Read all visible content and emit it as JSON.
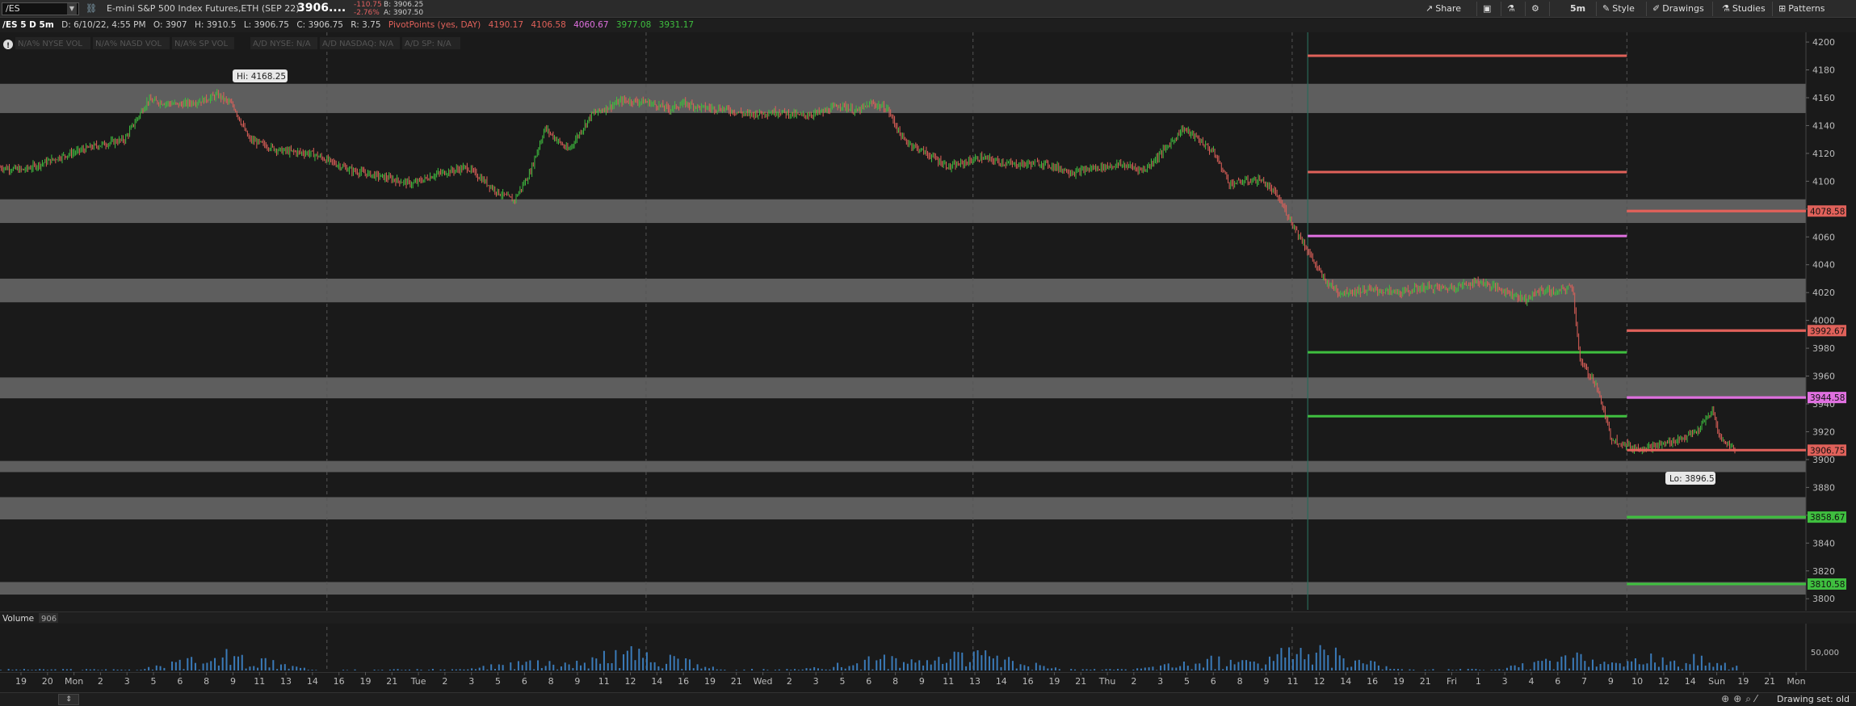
{
  "toolbar": {
    "symbol": "/ES",
    "description": "E-mini S&P 500 Index Futures,ETH (SEP 22)",
    "last": "3906....",
    "net_change": "-110.75",
    "pct_change": "-2.76%",
    "bid": "B: 3906.25",
    "ask": "A: 3907.50",
    "buttons": [
      "Share",
      "Drawings",
      "Studies",
      "Patterns"
    ],
    "style_label": "Style",
    "aggregation": "5m"
  },
  "infobar": {
    "chart_title": "/ES 5 D 5m",
    "date": "D: 6/10/22, 4:55 PM",
    "open": "O: 3907",
    "high": "H: 3910.5",
    "low": "L: 3906.75",
    "close": "C: 3906.75",
    "range": "R: 3.75",
    "pivot_label": "PivotPoints (yes, DAY)",
    "pivot_values": [
      "4190.17",
      "4106.58",
      "4060.67",
      "3977.08",
      "3931.17"
    ],
    "breadth": [
      "N/A% NYSE VOL",
      "N/A% NASD VOL",
      "N/A% SP VOL",
      "A/D NYSE: N/A",
      "A/D NASDAQ: N/A",
      "A/D SP: N/A"
    ]
  },
  "price_axis": {
    "ticks": [
      "4200",
      "4180",
      "4160",
      "4140",
      "4120",
      "4100",
      "4080",
      "4060",
      "4040",
      "4020",
      "4000",
      "3980",
      "3960",
      "3940",
      "3920",
      "3900",
      "3880",
      "3860",
      "3840",
      "3820",
      "3800"
    ],
    "tags": [
      {
        "text": "4078.58",
        "price": 4078.58,
        "color": "#e0615a"
      },
      {
        "text": "3992.67",
        "price": 3992.67,
        "color": "#e0615a"
      },
      {
        "text": "3944.58",
        "price": 3944.58,
        "color": "#e070e0"
      },
      {
        "text": "3906.75",
        "price": 3906.75,
        "color": "#e0615a"
      },
      {
        "text": "3858.67",
        "price": 3858.67,
        "color": "#3fbf3f"
      },
      {
        "text": "3810.58",
        "price": 3810.58,
        "color": "#3fbf3f"
      }
    ]
  },
  "annotations": {
    "high": "Hi: 4168.25",
    "low": "Lo: 3896.5"
  },
  "volume": {
    "label": "Volume",
    "value": "906",
    "axis_tick": "50,000"
  },
  "time_axis": {
    "labels": [
      "19",
      "20",
      "Mon",
      "2",
      "3",
      "5",
      "6",
      "8",
      "9",
      "11",
      "13",
      "14",
      "16",
      "19",
      "21",
      "Tue",
      "2",
      "3",
      "5",
      "6",
      "8",
      "9",
      "11",
      "12",
      "14",
      "16",
      "19",
      "21",
      "Wed",
      "2",
      "3",
      "5",
      "6",
      "8",
      "9",
      "11",
      "13",
      "14",
      "16",
      "19",
      "21",
      "Thu",
      "2",
      "3",
      "5",
      "6",
      "8",
      "9",
      "11",
      "12",
      "14",
      "16",
      "19",
      "21",
      "Fri",
      "1",
      "3",
      "4",
      "6",
      "7",
      "9",
      "10",
      "12",
      "14",
      "Sun",
      "19",
      "21",
      "Mon"
    ]
  },
  "status": {
    "drawing_set": "Drawing set: old"
  },
  "colors": {
    "up": "#3fbf3f",
    "down": "#e0615a",
    "pivot_pp": "#e070e0",
    "zone": "#6b6b6b"
  },
  "chart_data": {
    "type": "candlestick",
    "title": "/ES 5 D 5m",
    "ylim": [
      3792,
      4207
    ],
    "zones": [
      [
        4149,
        4170
      ],
      [
        4070,
        4087
      ],
      [
        4013,
        4030
      ],
      [
        3944,
        3959
      ],
      [
        3891,
        3899
      ],
      [
        3857,
        3873
      ],
      [
        3803,
        3812
      ]
    ],
    "levels": [
      {
        "price": 4190.17,
        "color": "#e0615a",
        "from": "Thu 16",
        "to": "Sun"
      },
      {
        "price": 4106.58,
        "color": "#e0615a",
        "from": "Thu 16",
        "to": "Sun"
      },
      {
        "price": 4060.67,
        "color": "#e070e0",
        "from": "Thu 16",
        "to": "Sun"
      },
      {
        "price": 3977.08,
        "color": "#3fbf3f",
        "from": "Thu 16",
        "to": "Sun"
      },
      {
        "price": 3931.17,
        "color": "#3fbf3f",
        "from": "Thu 16",
        "to": "Sun"
      },
      {
        "price": 4078.58,
        "color": "#e0615a",
        "from": "Sun",
        "to": "Mon"
      },
      {
        "price": 3992.67,
        "color": "#e0615a",
        "from": "Sun",
        "to": "Mon"
      },
      {
        "price": 3944.58,
        "color": "#e070e0",
        "from": "Sun",
        "to": "Mon"
      },
      {
        "price": 3858.67,
        "color": "#3fbf3f",
        "from": "Sun",
        "to": "Mon"
      },
      {
        "price": 3810.58,
        "color": "#3fbf3f",
        "from": "Sun",
        "to": "Mon"
      }
    ],
    "path": [
      [
        0,
        4110
      ],
      [
        3,
        4108
      ],
      [
        8,
        4118
      ],
      [
        12,
        4125
      ],
      [
        16,
        4130
      ],
      [
        19,
        4158
      ],
      [
        23,
        4155
      ],
      [
        26,
        4158
      ],
      [
        28,
        4162
      ],
      [
        30,
        4154
      ],
      [
        32,
        4130
      ],
      [
        36,
        4122
      ],
      [
        40,
        4120
      ],
      [
        45,
        4108
      ],
      [
        50,
        4102
      ],
      [
        53,
        4098
      ],
      [
        56,
        4105
      ],
      [
        60,
        4110
      ],
      [
        64,
        4092
      ],
      [
        66,
        4086
      ],
      [
        68,
        4105
      ],
      [
        70,
        4138
      ],
      [
        73,
        4122
      ],
      [
        76,
        4148
      ],
      [
        80,
        4158
      ],
      [
        83,
        4157
      ],
      [
        86,
        4152
      ],
      [
        88,
        4156
      ],
      [
        90,
        4153
      ],
      [
        93,
        4152
      ],
      [
        96,
        4148
      ],
      [
        100,
        4150
      ],
      [
        103,
        4147
      ],
      [
        106,
        4150
      ],
      [
        108,
        4155
      ],
      [
        110,
        4150
      ],
      [
        112,
        4156
      ],
      [
        114,
        4152
      ],
      [
        116,
        4130
      ],
      [
        119,
        4120
      ],
      [
        122,
        4110
      ],
      [
        126,
        4117
      ],
      [
        130,
        4112
      ],
      [
        134,
        4113
      ],
      [
        138,
        4106
      ],
      [
        140,
        4109
      ],
      [
        144,
        4112
      ],
      [
        147,
        4108
      ],
      [
        150,
        4125
      ],
      [
        152,
        4138
      ],
      [
        154,
        4130
      ],
      [
        156,
        4120
      ],
      [
        158,
        4098
      ],
      [
        160,
        4100
      ],
      [
        162,
        4101
      ],
      [
        164,
        4090
      ],
      [
        166,
        4070
      ],
      [
        170,
        4030
      ],
      [
        172,
        4020
      ],
      [
        176,
        4022
      ],
      [
        180,
        4020
      ],
      [
        183,
        4024
      ],
      [
        186,
        4023
      ],
      [
        190,
        4028
      ],
      [
        193,
        4022
      ],
      [
        196,
        4015
      ],
      [
        198,
        4022
      ],
      [
        200,
        4020
      ],
      [
        202,
        4025
      ],
      [
        203,
        3970
      ],
      [
        205,
        3955
      ],
      [
        207,
        3915
      ],
      [
        210,
        3908
      ],
      [
        213,
        3910
      ],
      [
        216,
        3915
      ],
      [
        218,
        3920
      ],
      [
        220,
        3935
      ],
      [
        221,
        3915
      ],
      [
        223,
        3907
      ]
    ],
    "volume_bursts": [
      {
        "x": 29,
        "h": 28
      },
      {
        "x": 71,
        "h": 25
      },
      {
        "x": 81,
        "h": 38
      },
      {
        "x": 114,
        "h": 23
      },
      {
        "x": 125,
        "h": 30
      },
      {
        "x": 156,
        "h": 20
      },
      {
        "x": 168,
        "h": 42
      },
      {
        "x": 203,
        "h": 24
      },
      {
        "x": 215,
        "h": 28
      }
    ]
  }
}
